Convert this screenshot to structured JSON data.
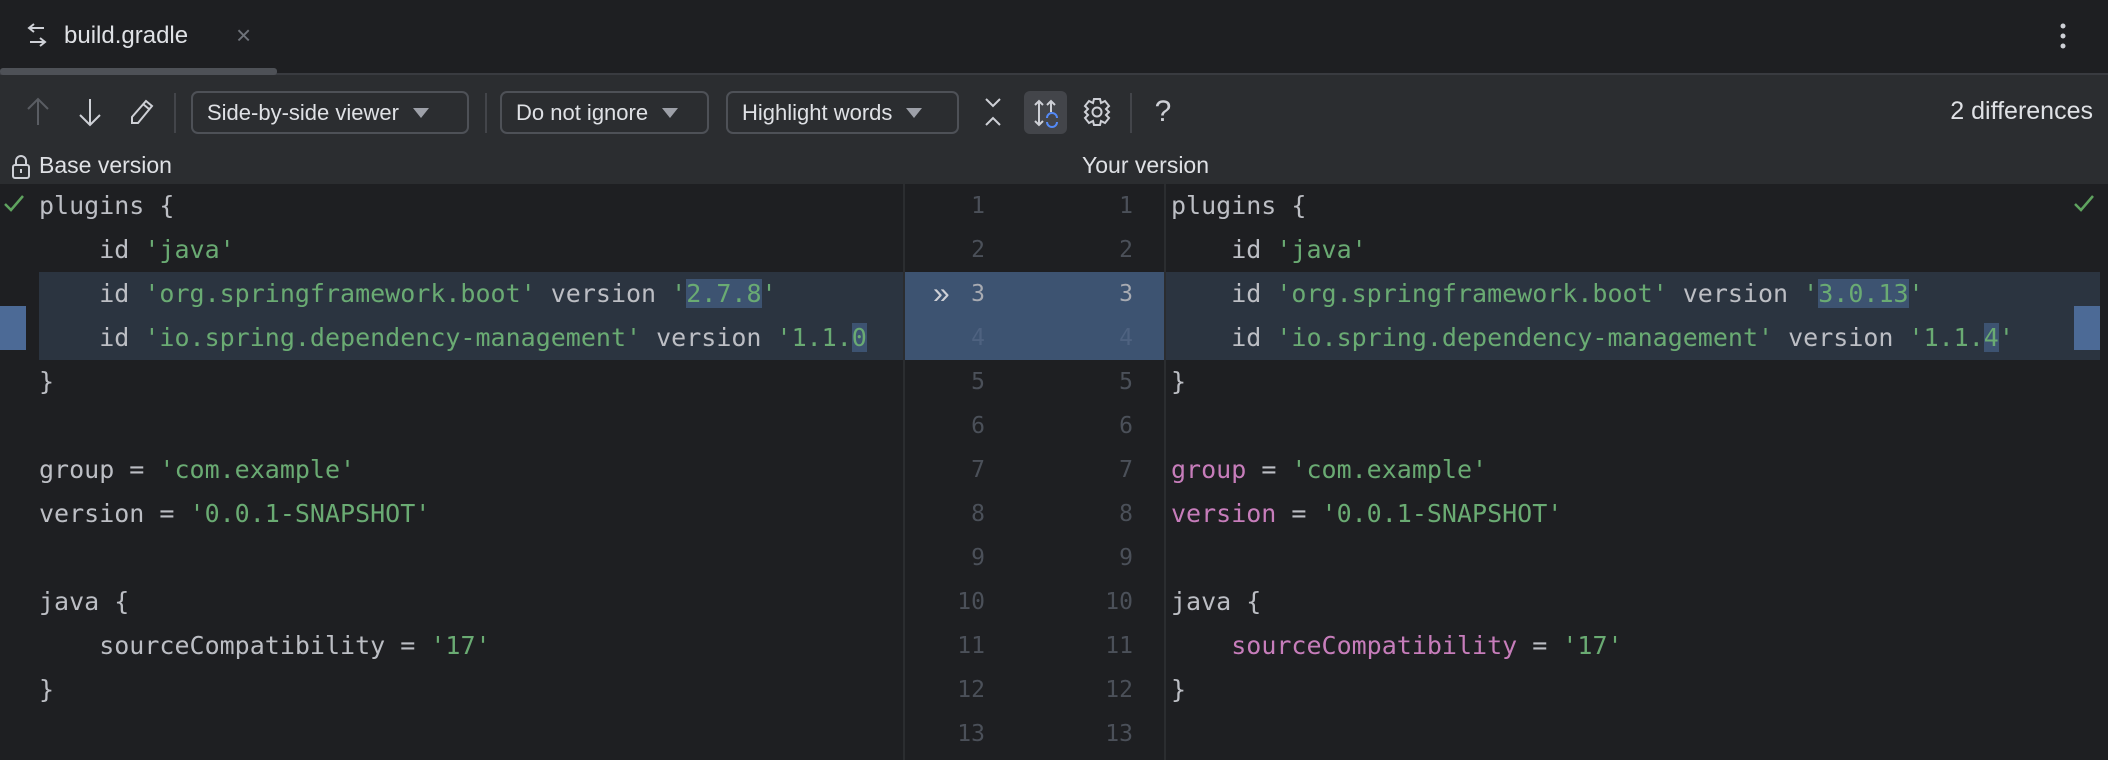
{
  "tab": {
    "title": "build.gradle",
    "icon": "diff-icon",
    "close_label": "×"
  },
  "toolbar": {
    "viewer": "Side-by-side viewer",
    "ignore": "Do not ignore",
    "highlight": "Highlight words",
    "help_label": "?",
    "differences": "2 differences"
  },
  "header": {
    "left": "Base version",
    "right": "Your version"
  },
  "gutter": {
    "left_numbers": [
      "1",
      "2",
      "3",
      "4",
      "5",
      "6",
      "7",
      "8",
      "9",
      "10",
      "11",
      "12",
      "13"
    ],
    "right_numbers": [
      "1",
      "2",
      "3",
      "4",
      "5",
      "6",
      "7",
      "8",
      "9",
      "10",
      "11",
      "12",
      "13"
    ],
    "changed": [
      3,
      4
    ],
    "apply_marker": "»"
  },
  "left_lines": [
    [
      {
        "t": "plugins {",
        "c": "plain"
      }
    ],
    [
      {
        "t": "    id ",
        "c": "plain"
      },
      {
        "t": "'java'",
        "c": "str"
      }
    ],
    [
      {
        "t": "    id ",
        "c": "plain"
      },
      {
        "t": "'org.springframework.boot'",
        "c": "str"
      },
      {
        "t": " version ",
        "c": "plain"
      },
      {
        "t": "'",
        "c": "str"
      },
      {
        "t": "2.7.8",
        "c": "str",
        "hl": true
      },
      {
        "t": "'",
        "c": "str"
      }
    ],
    [
      {
        "t": "    id ",
        "c": "plain"
      },
      {
        "t": "'io.spring.dependency-management'",
        "c": "str"
      },
      {
        "t": " version ",
        "c": "plain"
      },
      {
        "t": "'1.1.",
        "c": "str"
      },
      {
        "t": "0",
        "c": "str",
        "hl": true
      }
    ],
    [
      {
        "t": "}",
        "c": "plain"
      }
    ],
    [],
    [
      {
        "t": "group = ",
        "c": "plain"
      },
      {
        "t": "'com.example'",
        "c": "str"
      }
    ],
    [
      {
        "t": "version = ",
        "c": "plain"
      },
      {
        "t": "'0.0.1-SNAPSHOT'",
        "c": "str"
      }
    ],
    [],
    [
      {
        "t": "java {",
        "c": "plain"
      }
    ],
    [
      {
        "t": "    sourceCompatibility = ",
        "c": "plain"
      },
      {
        "t": "'17'",
        "c": "str"
      }
    ],
    [
      {
        "t": "}",
        "c": "plain"
      }
    ],
    []
  ],
  "right_lines": [
    [
      {
        "t": "plugins {",
        "c": "plain"
      }
    ],
    [
      {
        "t": "    id ",
        "c": "plain"
      },
      {
        "t": "'java'",
        "c": "str"
      }
    ],
    [
      {
        "t": "    id ",
        "c": "plain"
      },
      {
        "t": "'org.springframework.boot'",
        "c": "str"
      },
      {
        "t": " version ",
        "c": "plain"
      },
      {
        "t": "'",
        "c": "str"
      },
      {
        "t": "3.0.13",
        "c": "str",
        "hl": true
      },
      {
        "t": "'",
        "c": "str"
      }
    ],
    [
      {
        "t": "    id ",
        "c": "plain"
      },
      {
        "t": "'io.spring.dependency-management'",
        "c": "str"
      },
      {
        "t": " version ",
        "c": "plain"
      },
      {
        "t": "'1.1.",
        "c": "str"
      },
      {
        "t": "4",
        "c": "str",
        "hl": true
      },
      {
        "t": "'",
        "c": "str"
      }
    ],
    [
      {
        "t": "}",
        "c": "plain"
      }
    ],
    [],
    [
      {
        "t": "group",
        "c": "prop"
      },
      {
        "t": " = ",
        "c": "plain"
      },
      {
        "t": "'com.example'",
        "c": "str"
      }
    ],
    [
      {
        "t": "version",
        "c": "prop"
      },
      {
        "t": " = ",
        "c": "plain"
      },
      {
        "t": "'0.0.1-SNAPSHOT'",
        "c": "str"
      }
    ],
    [],
    [
      {
        "t": "java {",
        "c": "plain"
      }
    ],
    [
      {
        "t": "    ",
        "c": "plain"
      },
      {
        "t": "sourceCompatibility",
        "c": "prop"
      },
      {
        "t": " = ",
        "c": "plain"
      },
      {
        "t": "'17'",
        "c": "str"
      }
    ],
    [
      {
        "t": "}",
        "c": "plain"
      }
    ],
    []
  ],
  "colors": {
    "accent": "#548af7",
    "string": "#6aab73",
    "property": "#c77dbb",
    "check": "#5fa35f",
    "change": "#3d5371"
  }
}
